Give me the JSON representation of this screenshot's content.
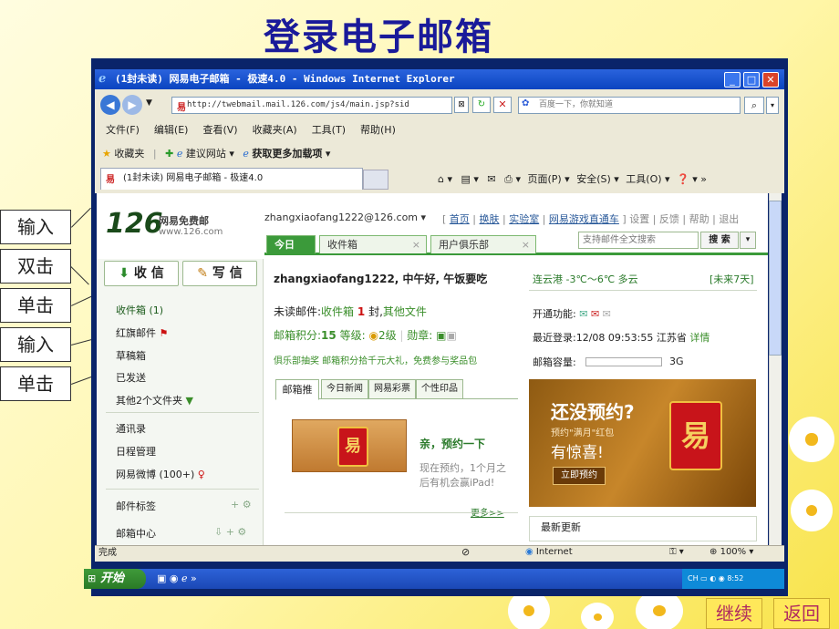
{
  "slide": {
    "title": "登录电子邮箱",
    "labels": [
      "输入",
      "双击",
      "单击",
      "输入",
      "单击"
    ],
    "continue": "继续",
    "back": "返回"
  },
  "window": {
    "title": "(1封未读) 网易电子邮箱 - 极速4.0 - Windows Internet Explorer",
    "address": "http://twebmail.mail.126.com/js4/main.jsp?sid",
    "search_placeholder": "百度一下，你就知道",
    "menu": [
      "文件(F)",
      "编辑(E)",
      "查看(V)",
      "收藏夹(A)",
      "工具(T)",
      "帮助(H)"
    ],
    "favorites": "收藏夹",
    "suggest": "建议网站",
    "addons": "获取更多加载项",
    "tab": "(1封未读) 网易电子邮箱 - 极速4.0",
    "cmdbar": [
      "页面(P)",
      "安全(S)",
      "工具(O)"
    ],
    "status": "完成",
    "zone": "Internet",
    "zoom": "100%"
  },
  "mail": {
    "logo": "126",
    "logo_text": "网易免费邮",
    "logo_url": "www.126.com",
    "user": "zhangxiaofang1222@126.com",
    "toplinks": [
      "首页",
      "换肤",
      "实验室",
      "网易游戏直通车",
      "设置",
      "反馈",
      "帮助",
      "退出"
    ],
    "tabs": [
      "今日",
      "收件箱",
      "用户俱乐部"
    ],
    "search_placeholder": "支持邮件全文搜索",
    "search_btn": "搜 索",
    "receive": "收 信",
    "write": "写 信",
    "folders": [
      "收件箱 (1)",
      "红旗邮件",
      "草稿箱",
      "已发送",
      "其他2个文件夹"
    ],
    "apps": [
      "通讯录",
      "日程管理",
      "网易微博 (100+)"
    ],
    "labels": "邮件标签",
    "center": "邮箱中心",
    "greeting": "zhangxiaofang1222, 中午好, 午饭要吃",
    "unread_prefix": "未读邮件:",
    "unread_box": "收件箱",
    "unread_count": "1",
    "unread_suffix": "封,",
    "unread_other": "其他文件",
    "points_label": "邮箱积分:",
    "points": "15",
    "level_label": "等级:",
    "level": "2级",
    "medal_label": "勋章:",
    "promo": "俱乐部抽奖 邮箱积分拾千元大礼，免费参与奖品包",
    "subtabs": [
      "邮箱推",
      "今日新闻",
      "网易彩票",
      "个性印品"
    ],
    "card_title": "亲，预约一下",
    "card_text": "现在预约，1个月之后有机会赢iPad!",
    "more": "更多>>",
    "weather": "连云港 -3℃～6℃ 多云",
    "forecast": "[未来7天]",
    "features": "开通功能:",
    "last_login_label": "最近登录:",
    "last_login": "12/08 09:53:55 江苏省",
    "detail": "详情",
    "capacity_label": "邮箱容量:",
    "capacity": "3G",
    "banner_title": "还没预约?",
    "banner_sub": "预约\"满月\"红包",
    "banner_line": "有惊喜!",
    "banner_btn": "立即预约",
    "latest": "最新更新"
  },
  "taskbar": {
    "start": "开始",
    "tray": "CH",
    "clock": "8:52"
  }
}
